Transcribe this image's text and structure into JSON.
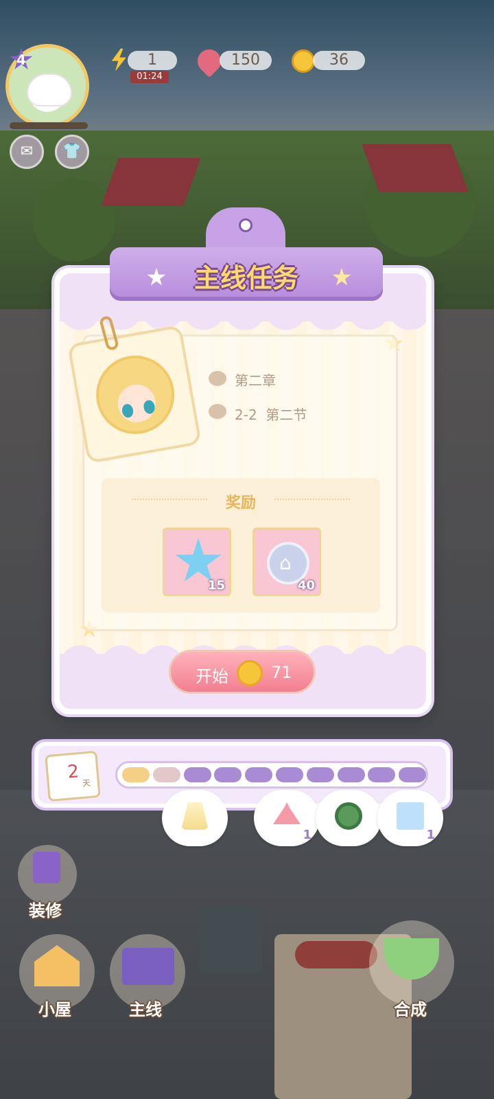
{
  "hud": {
    "level": "4",
    "energy": "1",
    "energy_timer": "01:24",
    "gems": "150",
    "coins": "36"
  },
  "modal": {
    "title": "主线任务",
    "chapter": "第二章",
    "section": "2-2  第二节",
    "reward_title": "奖励",
    "rewards": [
      {
        "icon": "blue-star-icon",
        "count": "15"
      },
      {
        "icon": "silver-coin-icon",
        "count": "40"
      }
    ],
    "start_label": "开始",
    "start_cost": "71"
  },
  "progress": {
    "days": "2",
    "days_unit": "天",
    "filled_segments": 1,
    "total_segments": 10,
    "milestones": [
      {
        "icon": "skirt-icon",
        "count": ""
      },
      {
        "icon": "hanger-icon",
        "count": "1"
      },
      {
        "icon": "green-bracelet-icon",
        "count": ""
      },
      {
        "icon": "shopping-bag-icon",
        "count": "1"
      }
    ]
  },
  "nav": {
    "decorate": "装修",
    "house": "小屋",
    "main": "主线",
    "merge": "合成"
  },
  "colors": {
    "accent_purple": "#b68cdc",
    "title_gold": "#ffd86e",
    "start_pink": "#f27f90"
  }
}
